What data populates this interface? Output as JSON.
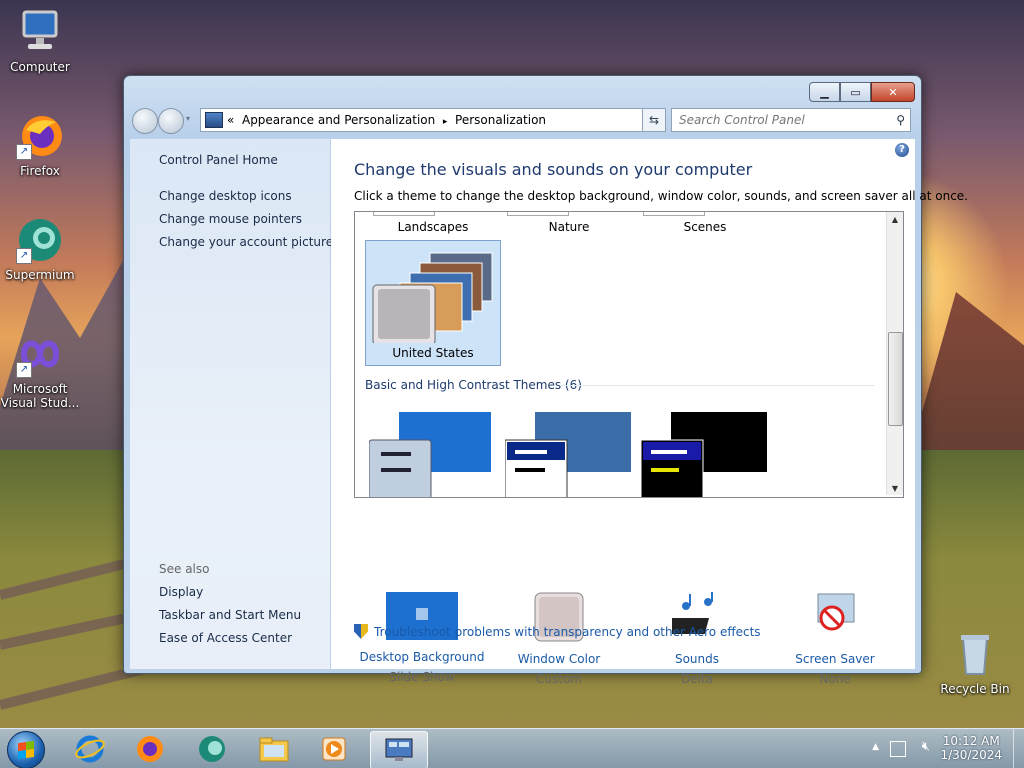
{
  "desktop": {
    "icons": [
      {
        "label": "Computer"
      },
      {
        "label": "Firefox"
      },
      {
        "label": "Supermium"
      },
      {
        "label": "Microsoft Visual Stud..."
      },
      {
        "label": "Recycle Bin"
      }
    ]
  },
  "window": {
    "address": {
      "prefix": "«",
      "crumb1": "Appearance and Personalization",
      "separator": "▸",
      "crumb2": "Personalization"
    },
    "search_placeholder": "Search Control Panel",
    "sidebar": {
      "home": "Control Panel Home",
      "links": [
        "Change desktop icons",
        "Change mouse pointers",
        "Change your account picture"
      ],
      "see_also_title": "See also",
      "see_also": [
        "Display",
        "Taskbar and Start Menu",
        "Ease of Access Center"
      ]
    },
    "content": {
      "heading": "Change the visuals and sounds on your computer",
      "subtext": "Click a theme to change the desktop background, window color, sounds, and screen saver all at once.",
      "top_themes": [
        "Landscapes",
        "Nature",
        "Scenes"
      ],
      "selected_theme": "United States",
      "basic_section": "Basic and High Contrast Themes (6)",
      "bottom_items": [
        {
          "label": "Desktop Background",
          "value": "Slide Show"
        },
        {
          "label": "Window Color",
          "value": "Custom"
        },
        {
          "label": "Sounds",
          "value": "Delta"
        },
        {
          "label": "Screen Saver",
          "value": "None"
        }
      ],
      "troubleshoot": "Troubleshoot problems with transparency and other Aero effects"
    }
  },
  "taskbar": {
    "time": "10:12 AM",
    "date": "1/30/2024"
  },
  "colors": {
    "link": "#1a5aa8",
    "heading": "#1e3a6e",
    "selection": "#cde3f8"
  }
}
